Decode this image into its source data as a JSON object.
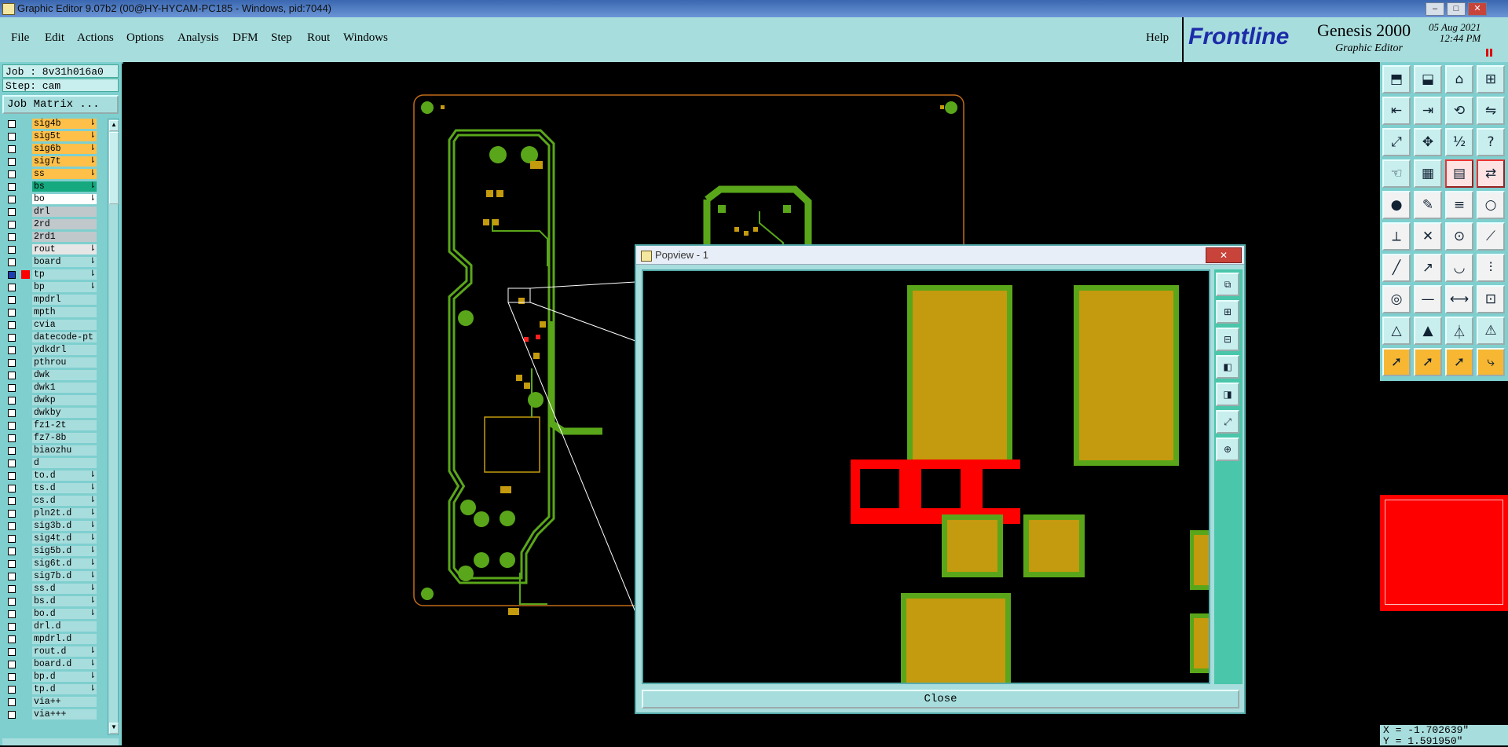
{
  "window": {
    "title": "Graphic Editor 9.07b2 (00@HY-HYCAM-PC185 - Windows, pid:7044)",
    "controls": [
      "–",
      "□",
      "✕"
    ]
  },
  "menubar": {
    "items": [
      "File",
      "Edit",
      "Actions",
      "Options",
      "Analysis",
      "DFM",
      "Step",
      "Rout",
      "Windows"
    ],
    "help": "Help"
  },
  "brand": {
    "logo": "Frontline",
    "product": "Genesis 2000",
    "subtitle": "Graphic Editor",
    "date": "05 Aug 2021",
    "time": "12:44 PM"
  },
  "left_panel": {
    "job": "Job : 8v31h016a0",
    "step": "Step: cam",
    "job_matrix": "Job Matrix ..."
  },
  "layers": [
    {
      "name": "sig4b",
      "color": "#ffc04a",
      "arrow": "⇂"
    },
    {
      "name": "sig5t",
      "color": "#ffc04a",
      "arrow": "⇂"
    },
    {
      "name": "sig6b",
      "color": "#ffc04a",
      "arrow": "⇂"
    },
    {
      "name": "sig7t",
      "color": "#ffc04a",
      "arrow": "⇂"
    },
    {
      "name": "ss",
      "color": "#ffc04a",
      "arrow": "⇂"
    },
    {
      "name": "bs",
      "color": "#16a87e",
      "arrow": "⇂"
    },
    {
      "name": "bo",
      "color": "#ffffff",
      "arrow": "⇂"
    },
    {
      "name": "drl",
      "color": "#c0c8cc",
      "arrow": ""
    },
    {
      "name": "2rd",
      "color": "#c0c8cc",
      "arrow": ""
    },
    {
      "name": "2rd1",
      "color": "#c0c8cc",
      "arrow": ""
    },
    {
      "name": "rout",
      "color": "#e6e6e6",
      "arrow": "⇂"
    },
    {
      "name": "board",
      "color": "#a8dddd",
      "arrow": "⇂"
    },
    {
      "name": "tp",
      "color": "#a8dddd",
      "arrow": "⇂"
    },
    {
      "name": "bp",
      "color": "#a8dddd",
      "arrow": "⇂"
    },
    {
      "name": "mpdrl",
      "color": "#a8dddd",
      "arrow": ""
    },
    {
      "name": "mpth",
      "color": "#a8dddd",
      "arrow": ""
    },
    {
      "name": "cvia",
      "color": "#a8dddd",
      "arrow": ""
    },
    {
      "name": "datecode-pt",
      "color": "#a8dddd",
      "arrow": ""
    },
    {
      "name": "ydkdrl",
      "color": "#a8dddd",
      "arrow": ""
    },
    {
      "name": "pthrou",
      "color": "#a8dddd",
      "arrow": ""
    },
    {
      "name": "dwk",
      "color": "#a8dddd",
      "arrow": ""
    },
    {
      "name": "dwk1",
      "color": "#a8dddd",
      "arrow": ""
    },
    {
      "name": "dwkp",
      "color": "#a8dddd",
      "arrow": ""
    },
    {
      "name": "dwkby",
      "color": "#a8dddd",
      "arrow": ""
    },
    {
      "name": "fz1-2t",
      "color": "#a8dddd",
      "arrow": ""
    },
    {
      "name": "fz7-8b",
      "color": "#a8dddd",
      "arrow": ""
    },
    {
      "name": "biaozhu",
      "color": "#a8dddd",
      "arrow": ""
    },
    {
      "name": "d",
      "color": "#a8dddd",
      "arrow": ""
    },
    {
      "name": "to.d",
      "color": "#a8dddd",
      "arrow": "⇂"
    },
    {
      "name": "ts.d",
      "color": "#a8dddd",
      "arrow": "⇂"
    },
    {
      "name": "cs.d",
      "color": "#a8dddd",
      "arrow": "⇂"
    },
    {
      "name": "pln2t.d",
      "color": "#a8dddd",
      "arrow": "⇂"
    },
    {
      "name": "sig3b.d",
      "color": "#a8dddd",
      "arrow": "⇂"
    },
    {
      "name": "sig4t.d",
      "color": "#a8dddd",
      "arrow": "⇂"
    },
    {
      "name": "sig5b.d",
      "color": "#a8dddd",
      "arrow": "⇂"
    },
    {
      "name": "sig6t.d",
      "color": "#a8dddd",
      "arrow": "⇂"
    },
    {
      "name": "sig7b.d",
      "color": "#a8dddd",
      "arrow": "⇂"
    },
    {
      "name": "ss.d",
      "color": "#a8dddd",
      "arrow": "⇂"
    },
    {
      "name": "bs.d",
      "color": "#a8dddd",
      "arrow": "⇂"
    },
    {
      "name": "bo.d",
      "color": "#a8dddd",
      "arrow": "⇂"
    },
    {
      "name": "drl.d",
      "color": "#a8dddd",
      "arrow": ""
    },
    {
      "name": "mpdrl.d",
      "color": "#a8dddd",
      "arrow": ""
    },
    {
      "name": "rout.d",
      "color": "#a8dddd",
      "arrow": "⇂"
    },
    {
      "name": "board.d",
      "color": "#a8dddd",
      "arrow": "⇂"
    },
    {
      "name": "bp.d",
      "color": "#a8dddd",
      "arrow": "⇂"
    },
    {
      "name": "tp.d",
      "color": "#a8dddd",
      "arrow": "⇂"
    },
    {
      "name": "via++",
      "color": "#a8dddd",
      "arrow": ""
    },
    {
      "name": "via+++",
      "color": "#a8dddd",
      "arrow": ""
    }
  ],
  "popup": {
    "title": "Popview - 1",
    "close_label": "Close"
  },
  "status": {
    "x": "X = -1.702639\"",
    "y": "Y = 1.591950\""
  },
  "colors": {
    "copper": "#c49a0e",
    "green": "#5aa61a",
    "red": "#ff0000",
    "board_outline": "#c06a1a",
    "panel": "#a8dddd"
  },
  "toolbar_icons": [
    "open-job-icon",
    "save-icon",
    "home-icon",
    "window-split-icon",
    "zoom-in-icon",
    "zoom-out-icon",
    "pan-icon",
    "flip-icon",
    "fit-icon",
    "center-icon",
    "scale-1-2-icon",
    "help-query-icon",
    "hand-icon",
    "grid-icon",
    "layers-icon",
    "layer-compare-icon",
    "pad-icon",
    "line-add-icon",
    "line-style-icon",
    "circle-icon",
    "connect-nodes-icon",
    "cross-icon",
    "snap-node-icon",
    "snap-line-icon",
    "draw-line-icon",
    "measure-icon",
    "arc-icon",
    "filter-icon",
    "select-pad-icon",
    "minus-icon",
    "dimension-icon",
    "grid-fine-icon",
    "triangle-icon",
    "triangle-a-icon",
    "triangle-b-icon",
    "triangle-c-icon",
    "select-arrow-icon",
    "select-arrow2-icon",
    "select-arrow3-icon",
    "select-path-icon"
  ]
}
